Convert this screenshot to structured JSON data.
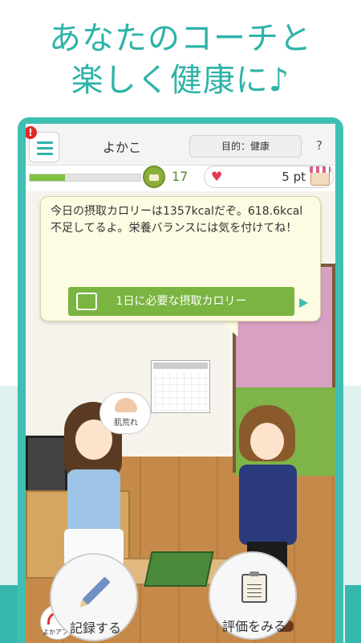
{
  "promo": {
    "headline_line1": "あなたのコーチと",
    "headline_line2": "楽しく健康に♪"
  },
  "header": {
    "notification_badge": "!",
    "username": "よかこ",
    "goal_label": "目的：健康",
    "help_label": "?"
  },
  "status": {
    "xp_progress": 0.32,
    "level": "17",
    "points": "5 pt"
  },
  "coach_message": {
    "text": "今日の摂取カロリーは1357kcalだぞ。618.6kcal不足してるよ。栄養バランスには気を付けてね！",
    "button_label": "1日に必要な摂取カロリー"
  },
  "scene": {
    "thought_label": "肌荒れ",
    "app_logo_text": "よかアプリ"
  },
  "actions": {
    "record_label": "記録する",
    "evaluate_label": "評価をみる"
  },
  "colors": {
    "accent": "#2fb3a8",
    "button_green": "#7ab441",
    "heart": "#e23b56"
  }
}
